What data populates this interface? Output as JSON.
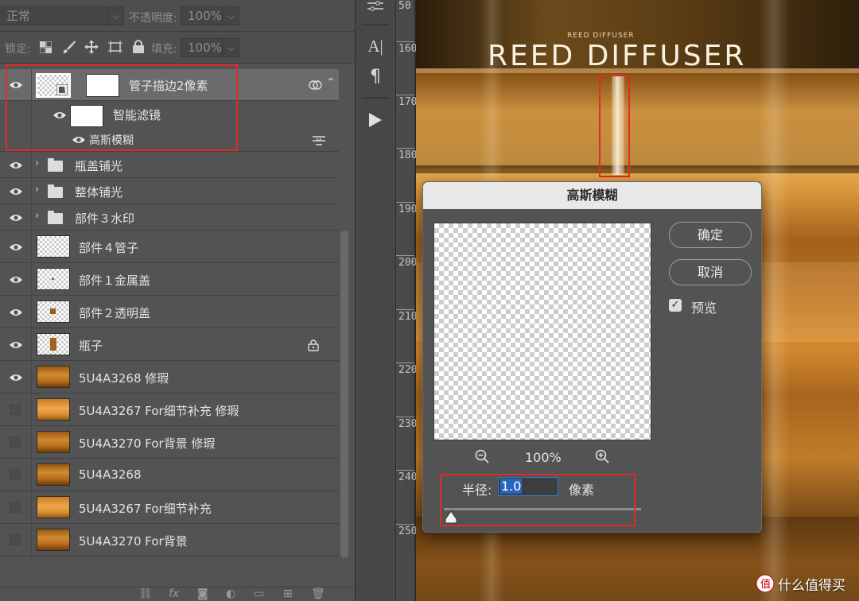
{
  "layers_panel": {
    "blend_mode": "正常",
    "opacity_label": "不透明度:",
    "opacity_value": "100%",
    "lock_label": "锁定:",
    "fill_label": "填充:",
    "fill_value": "100%",
    "layers": [
      {
        "name": "管子描边2像素",
        "selected": true,
        "visible": true
      },
      {
        "name": "智能滤镜",
        "visible": true
      },
      {
        "name": "高斯模糊",
        "visible": true
      },
      {
        "name": "瓶盖铺光",
        "type": "group",
        "visible": true
      },
      {
        "name": "整体铺光",
        "type": "group",
        "visible": true
      },
      {
        "name": "部件３水印",
        "type": "group",
        "visible": true
      },
      {
        "name": "部件４管子",
        "visible": true
      },
      {
        "name": "部件１金属盖",
        "visible": true
      },
      {
        "name": "部件２透明盖",
        "visible": true
      },
      {
        "name": "瓶子",
        "visible": true,
        "locked": true
      },
      {
        "name": "5U4A3268 修瑕",
        "visible": true
      },
      {
        "name": "5U4A3267 For细节补充 修瑕",
        "visible": false
      },
      {
        "name": "5U4A3270 For背景 修瑕",
        "visible": false
      },
      {
        "name": "5U4A3268",
        "visible": false
      },
      {
        "name": "5U4A3267 For细节补充",
        "visible": false
      },
      {
        "name": "5U4A3270 For背景",
        "visible": false
      }
    ],
    "bottom_icons": [
      "link-icon",
      "fx-icon",
      "mask-icon",
      "adjustment-icon",
      "folder-icon",
      "new-layer-icon",
      "trash-icon"
    ]
  },
  "ruler": {
    "labels": [
      "50",
      "160",
      "170",
      "180",
      "190",
      "200",
      "210",
      "220",
      "230",
      "240",
      "250"
    ]
  },
  "canvas": {
    "brand_small": "REED DIFFUSER",
    "brand_large": "REED DIFFUSER"
  },
  "dialog": {
    "title": "高斯模糊",
    "ok_label": "确定",
    "cancel_label": "取消",
    "preview_label": "预览",
    "preview_checked": true,
    "zoom": "100%",
    "radius_label": "半径:",
    "radius_value": "1.0",
    "radius_unit": "像素"
  },
  "watermark": "什么值得买",
  "colors": {
    "highlight_box": "#e02b27",
    "selection": "#2a65c2"
  }
}
